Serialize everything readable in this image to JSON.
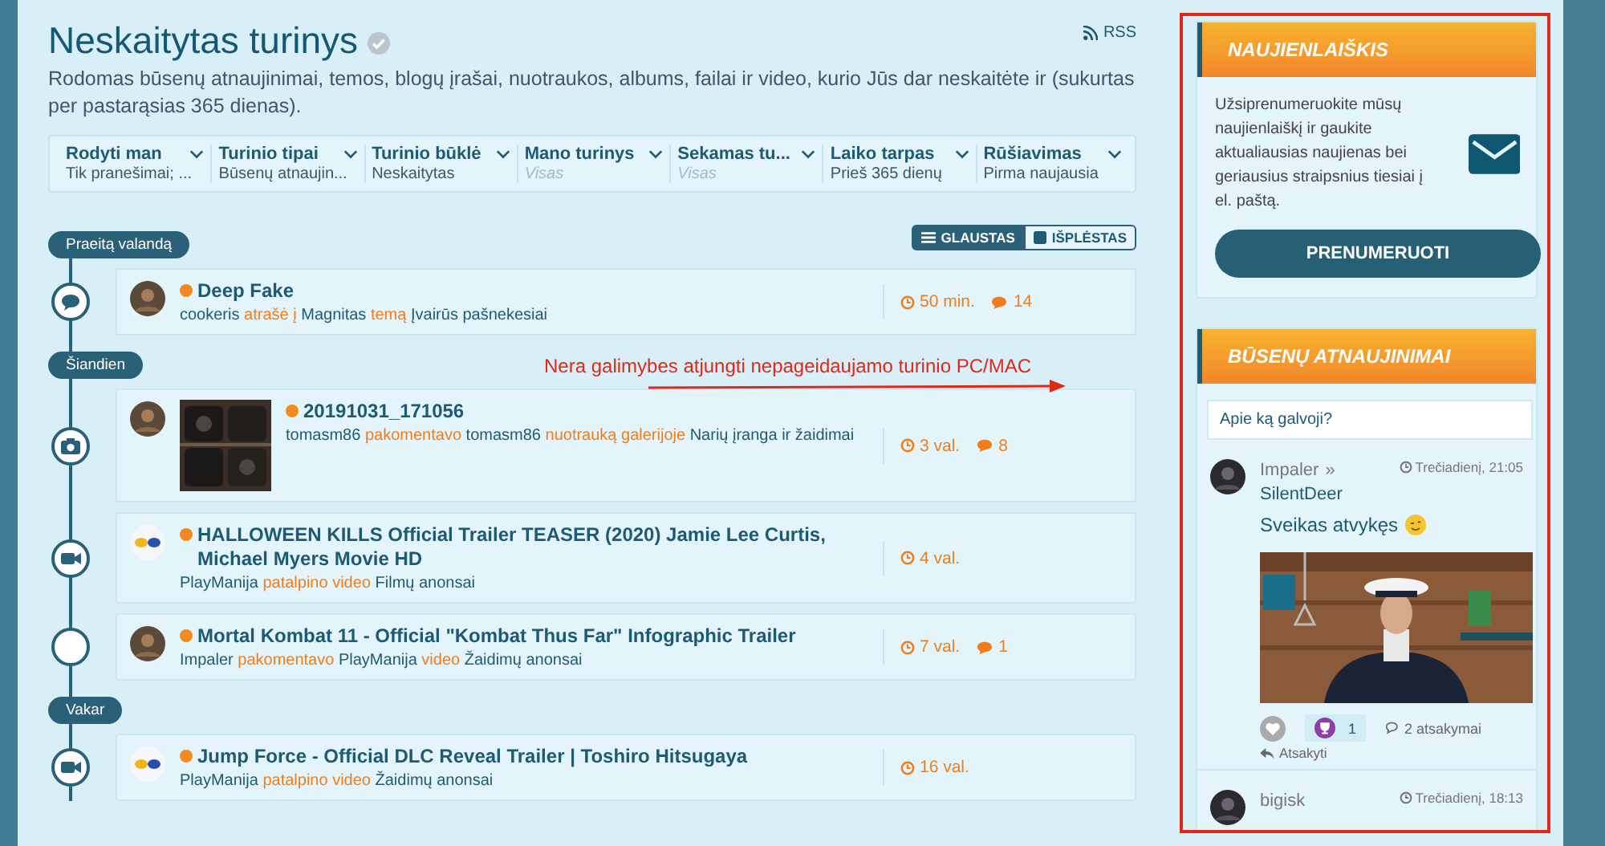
{
  "header": {
    "title": "Neskaitytas turinys",
    "rss": "RSS",
    "description": "Rodomas būsenų atnaujinimai, temos, blogų įrašai, nuotraukos, albums, failai ir video, kurio Jūs dar neskaitėte ir (sukurtas per pastarąsias 365 dienas)."
  },
  "filters": [
    {
      "label": "Rodyti man",
      "value": "Tik pranešimai; ...",
      "muted": false
    },
    {
      "label": "Turinio tipai",
      "value": "Būsenų atnaujin...",
      "muted": false
    },
    {
      "label": "Turinio būklė",
      "value": "Neskaitytas",
      "muted": false
    },
    {
      "label": "Mano turinys",
      "value": "Visas",
      "muted": true
    },
    {
      "label": "Sekamas tu...",
      "value": "Visas",
      "muted": true
    },
    {
      "label": "Laiko tarpas",
      "value": "Prieš 365 dienų",
      "muted": false
    },
    {
      "label": "Rūšiavimas",
      "value": "Pirma naujausia",
      "muted": false
    }
  ],
  "view_toggle": [
    {
      "label": "GLAUSTAS",
      "selected": true
    },
    {
      "label": "IŠPLĖSTAS",
      "selected": false
    }
  ],
  "annotation": "Nera galimybes atjungti nepageidaujamo turinio PC/MAC",
  "feed": [
    {
      "label": "Praeitą valandą",
      "items": [
        {
          "kind": "comment",
          "title": "Deep Fake",
          "meta": [
            {
              "text": "cookeris",
              "highlight": false
            },
            {
              "text": "atrašė į",
              "highlight": true
            },
            {
              "text": "Magnitas",
              "highlight": false
            },
            {
              "text": "temą",
              "highlight": true
            },
            {
              "text": "Įvairūs pašnekesiai",
              "highlight": false
            }
          ],
          "time": "50 min.",
          "comments": "14"
        }
      ]
    },
    {
      "label": "Šiandien",
      "items": [
        {
          "thumbnail": true,
          "title": "20191031_171056",
          "meta": [
            {
              "text": "tomasm86",
              "highlight": false
            },
            {
              "text": "pakomentavo",
              "highlight": true
            },
            {
              "text": "tomasm86",
              "highlight": false
            },
            {
              "text": "nuotrauką galerijoje",
              "highlight": true
            },
            {
              "text": "Narių įranga ir žaidimai",
              "highlight": false
            }
          ],
          "time": "3 val.",
          "comments": "8"
        },
        {
          "kind": "video",
          "avatar": {
            "kind": "logo"
          },
          "title": "HALLOWEEN KILLS Official Trailer TEASER (2020) Jamie Lee Curtis, Michael Myers Movie HD",
          "meta": [
            {
              "text": "PlayManija",
              "highlight": false
            },
            {
              "text": "patalpino video",
              "highlight": true
            },
            {
              "text": "Filmų anonsai",
              "highlight": false
            }
          ],
          "time": "4 val."
        },
        {
          "kind": "none",
          "title": "Mortal Kombat 11 - Official \"Kombat Thus Far\" Infographic Trailer",
          "meta": [
            {
              "text": "Impaler",
              "highlight": false
            },
            {
              "text": "pakomentavo",
              "highlight": true
            },
            {
              "text": "PlayManija",
              "highlight": false
            },
            {
              "text": "video",
              "highlight": true
            },
            {
              "text": "Žaidimų anonsai",
              "highlight": false
            }
          ],
          "time": "7 val.",
          "comments": "1"
        }
      ]
    },
    {
      "label": "Vakar",
      "items": [
        {
          "kind": "video",
          "avatar": {
            "kind": "logo"
          },
          "title": "Jump Force - Official DLC Reveal Trailer | Toshiro Hitsugaya",
          "meta": [
            {
              "text": "PlayManija",
              "highlight": false
            },
            {
              "text": "patalpino video",
              "highlight": true
            },
            {
              "text": "Žaidimų anonsai",
              "highlight": false
            }
          ],
          "time": "16 val."
        }
      ]
    }
  ],
  "newsletter": {
    "title": "NAUJIENLAIŠKIS",
    "text": "Užsiprenumeruokite mūsų naujienlaiškį ir gaukite aktualiausias naujienas bei geriausius straipsnius tiesiai į el. paštą.",
    "button": "PRENUMERUOTI"
  },
  "status_updates": {
    "title": "BŪSENŲ ATNAUJINIMAI",
    "placeholder": "Apie ką galvoji?",
    "posts": [
      {
        "author": "Impaler",
        "separator": "»",
        "target": "SilentDeer",
        "time": "Trečiadienį, 21:05",
        "text": "Sveikas atvykęs",
        "image": true,
        "reactions": "1",
        "replies": "2 atsakymai",
        "reply": "Atsakyti"
      },
      {
        "author": "bigisk",
        "time": "Trečiadienį, 18:13"
      }
    ]
  }
}
